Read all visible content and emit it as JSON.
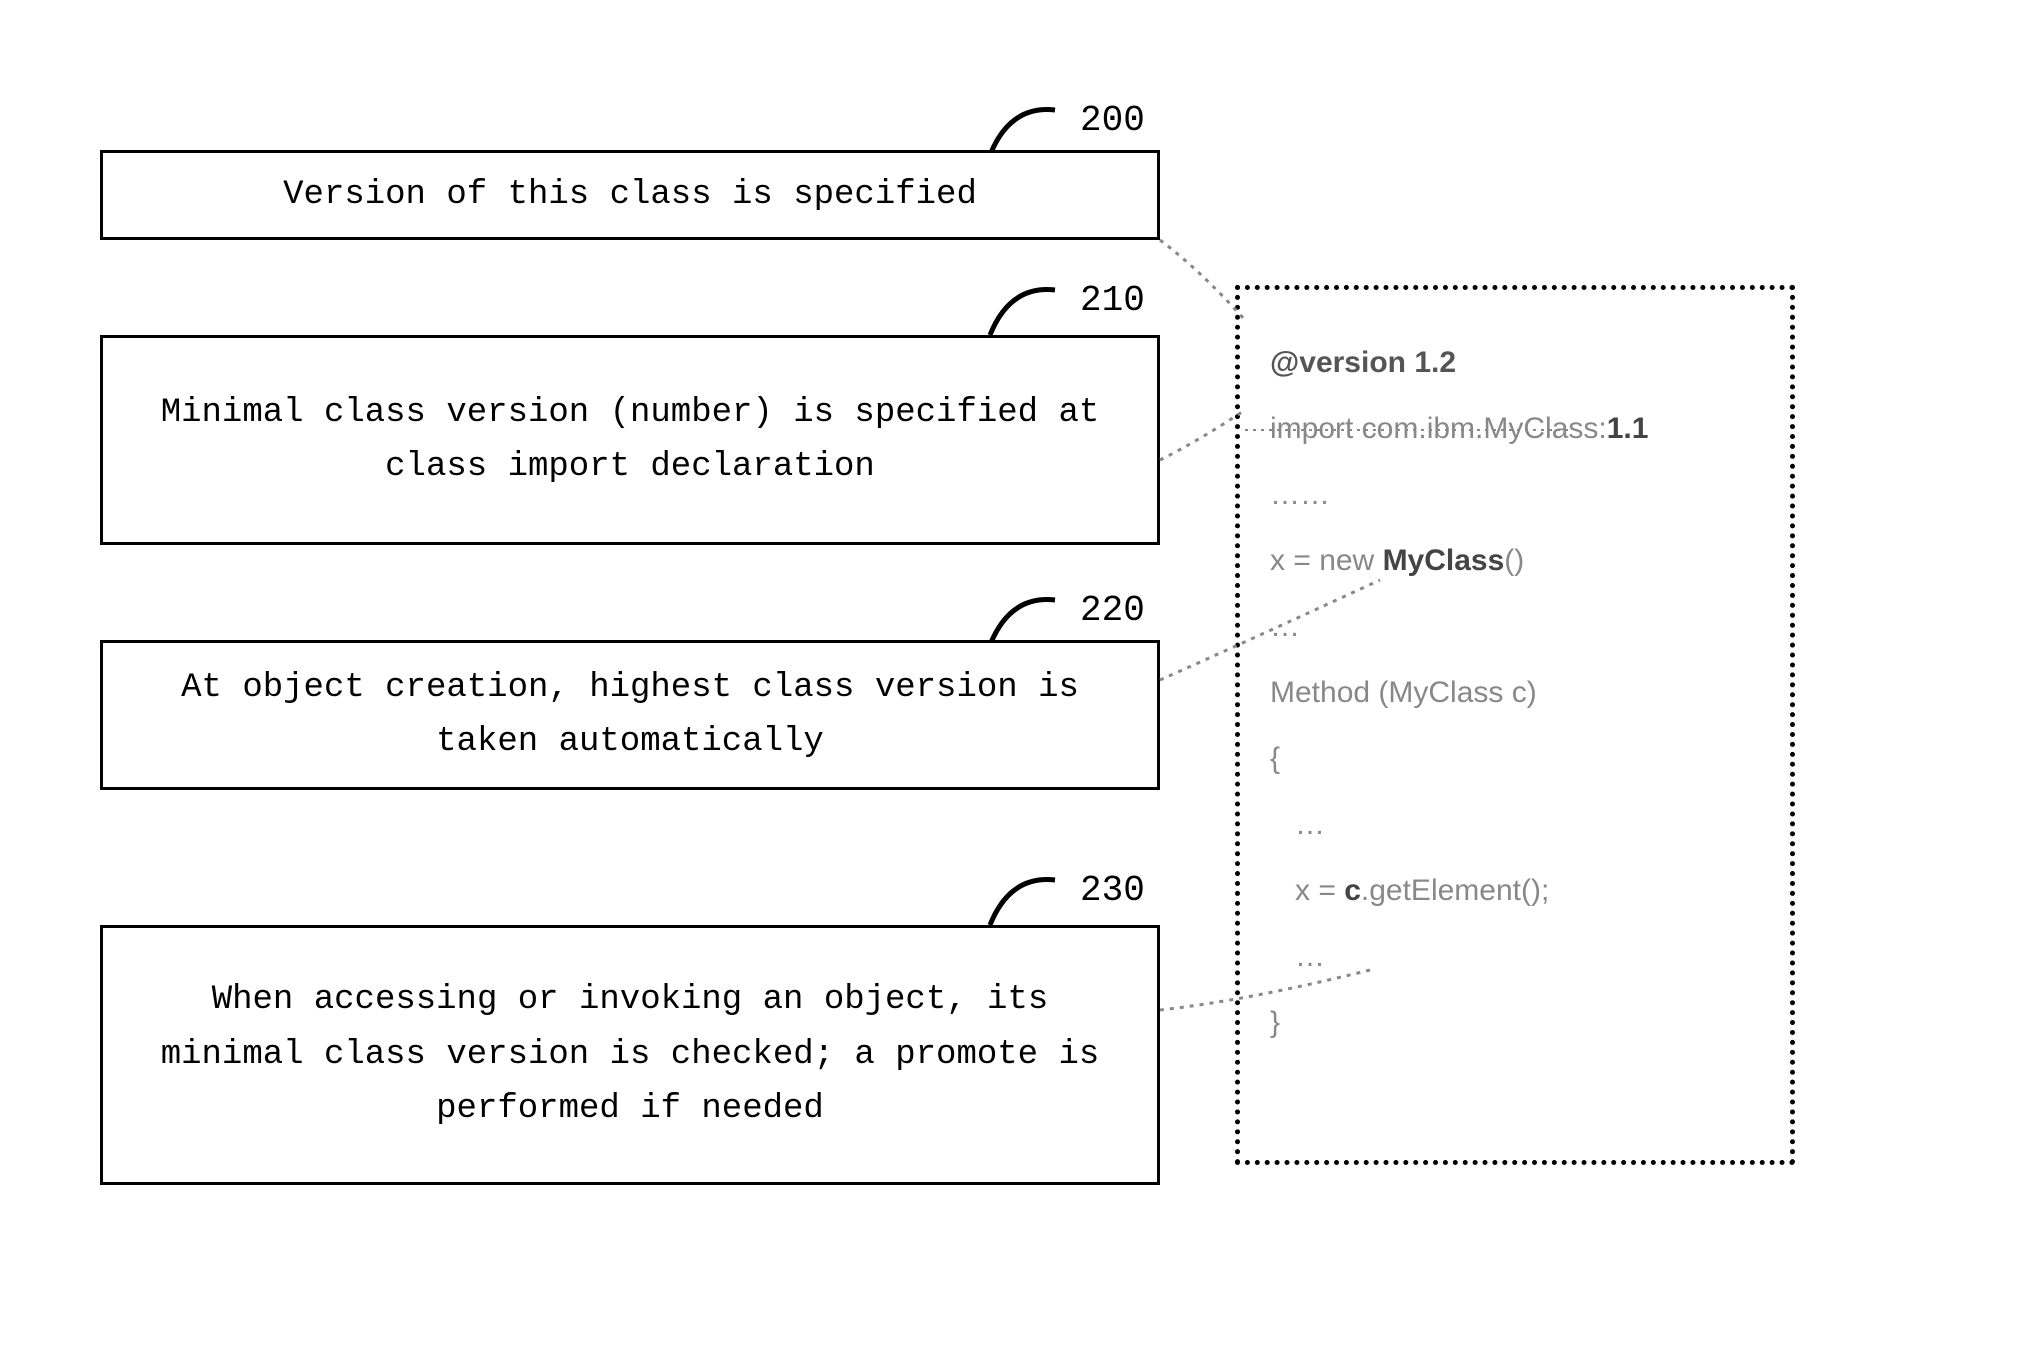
{
  "labels": {
    "n200": "200",
    "n210": "210",
    "n220": "220",
    "n230": "230"
  },
  "boxes": {
    "b200": "Version of this class is specified",
    "b210": "Minimal class version (number) is specified at class import declaration",
    "b220": "At object creation, highest class version is taken automatically",
    "b230": "When accessing or invoking an object, its minimal class version is checked; a promote is performed if needed"
  },
  "code": {
    "l1a": "@version ",
    "l1b": "1.2",
    "l2a": "import com.ibm.MyClass:",
    "l2b": "1.1",
    "l3": "……",
    "l4a": "x = new ",
    "l4b": "MyClass",
    "l4c": "()",
    "l5": "…",
    "l6": "Method (MyClass c)",
    "l7": "{",
    "l8": "   …",
    "l9a": "   x = ",
    "l9b": "c",
    "l9c": ".getElement();",
    "l10": "   …",
    "l11": "}"
  }
}
